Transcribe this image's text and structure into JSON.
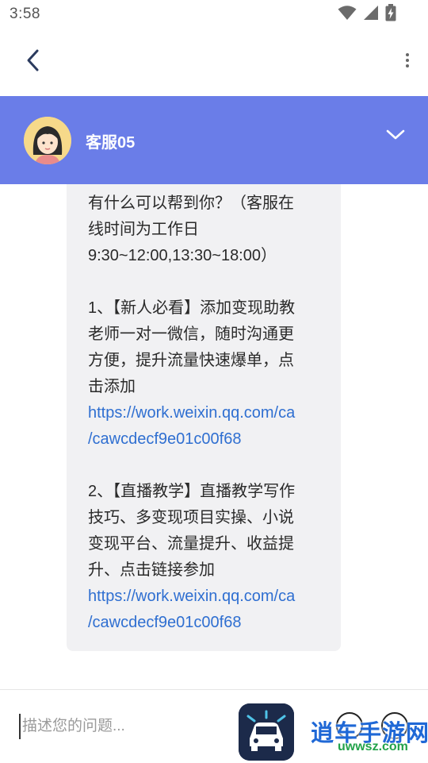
{
  "status_bar": {
    "time": "3:58",
    "icons": [
      "wifi-icon",
      "signal-icon",
      "battery-charging-icon"
    ]
  },
  "nav": {
    "back_icon": "chevron-left-icon",
    "more_icon": "more-vertical-icon"
  },
  "agent": {
    "name": "客服05",
    "avatar_icon": "cartoon-girl-avatar",
    "collapse_icon": "chevron-down-icon",
    "header_color": "#6a7de8"
  },
  "message": {
    "lines": [
      "有什么可以帮到你？（客服在",
      "线时间为工作日",
      "9:30~12:00,13:30~18:00）",
      "",
      "1、【新人必看】添加变现助教",
      "老师一对一微信，随时沟通更",
      "方便，提升流量快速爆单，点",
      "击添加",
      "https://work.weixin.qq.com/ca",
      "/cawcdecf9e01c00f68",
      "",
      "2、【直播教学】直播教学写作",
      "技巧、多变现项目实操、小说",
      "变现平台、流量提升、收益提",
      "升、点击链接参加",
      "https://work.weixin.qq.com/ca",
      "/cawcdecf9e01c00f68"
    ],
    "link_color": "#2f6fd1"
  },
  "input": {
    "placeholder": "描述您的问题...",
    "emoji_icon": "smile-icon",
    "plus_icon": "plus-circle-icon",
    "logo_icon": "app-logo-car-icon"
  },
  "watermark": {
    "title": "逍车手游网",
    "url": "uwwsz.com"
  }
}
